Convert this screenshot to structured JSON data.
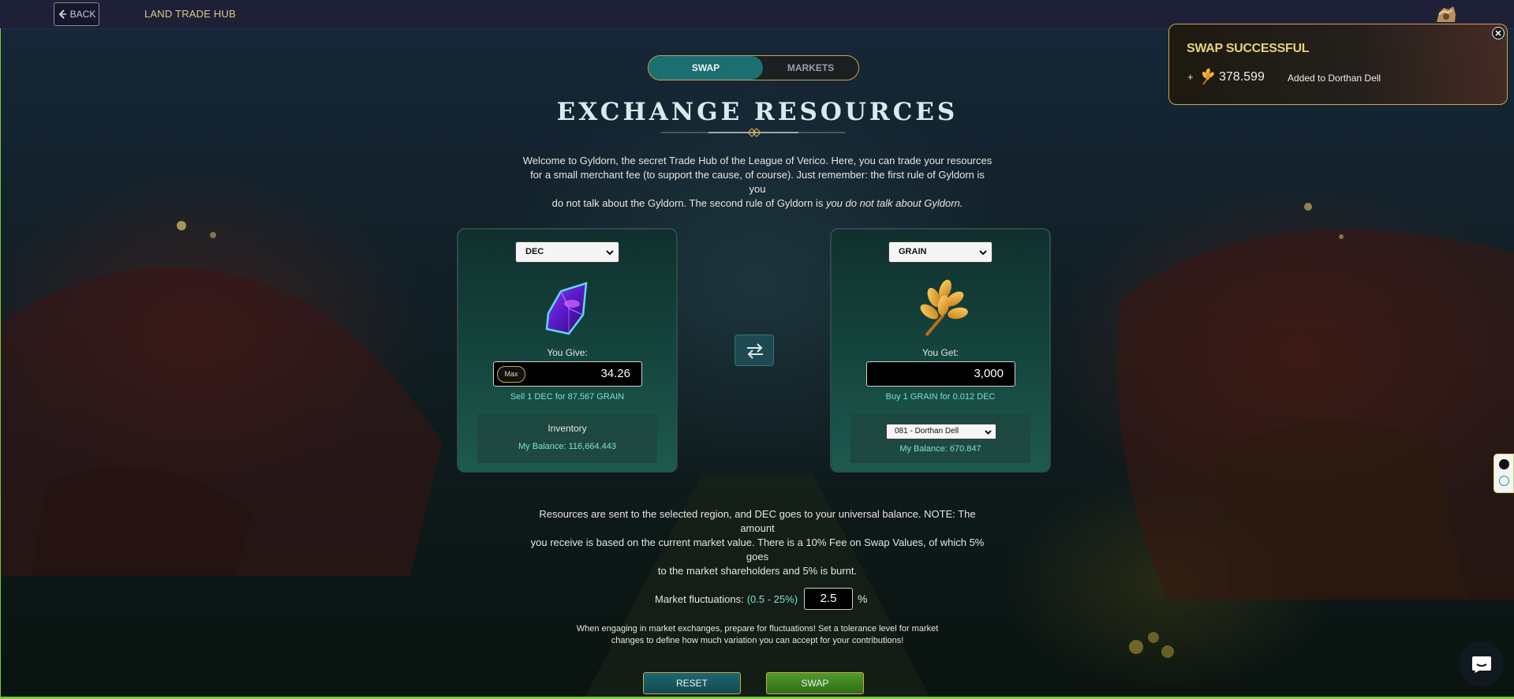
{
  "topbar": {
    "back_label": "BACK",
    "title": "LAND TRADE HUB"
  },
  "tabs": [
    {
      "label": "SWAP",
      "active": true
    },
    {
      "label": "MARKETS",
      "active": false
    }
  ],
  "page": {
    "title": "EXCHANGE RESOURCES",
    "intro_line1": "Welcome to Gyldorn, the secret Trade Hub of the League of Verico. Here, you can trade your resources",
    "intro_line2": "for a small merchant fee (to support the cause, of course). Just remember: the first rule of Gyldorn is you",
    "intro_line3_plain": "do not talk about the Gyldorn. The second rule of Gyldorn is ",
    "intro_line3_italic": "you do not talk about Gyldorn."
  },
  "give_panel": {
    "token": "DEC",
    "label": "You Give:",
    "max_label": "Max",
    "amount": "34.26",
    "rate": "Sell 1 DEC for 87.567 GRAIN",
    "inventory_title": "Inventory",
    "balance": "My Balance: 116,664.443"
  },
  "get_panel": {
    "token": "GRAIN",
    "label": "You Get:",
    "amount": "3,000",
    "rate": "Buy 1 GRAIN for 0.012 DEC",
    "region": "081 - Dorthan Dell",
    "balance": "My Balance: 670.847"
  },
  "note": {
    "line1": "Resources are sent to the selected region, and DEC goes to your universal balance. NOTE: The amount",
    "line2": "you receive is based on the current market value. There is a 10% Fee on Swap Values, of which 5% goes",
    "line3": "to the market shareholders and 5% is burnt."
  },
  "fluctuation": {
    "label": "Market fluctuations:",
    "range": "(0.5 - 25%)",
    "value": "2.5",
    "unit": "%",
    "help_line1": "When engaging in market exchanges, prepare for fluctuations! Set a tolerance level for market",
    "help_line2": "changes to define how much variation you can accept for your contributions!"
  },
  "actions": {
    "reset_label": "RESET",
    "swap_label": "SWAP"
  },
  "toast": {
    "title": "SWAP SUCCESSFUL",
    "plus": "+",
    "amount": "378.599",
    "message": "Added to Dorthan Dell"
  },
  "icons": {
    "back": "chevron-left-icon",
    "swap_direction": "swap-arrows-icon",
    "dec": "crystal-icon",
    "grain": "wheat-icon",
    "close": "close-icon",
    "chat": "chat-icon"
  },
  "colors": {
    "accent_gold": "#c9a84c",
    "accent_teal": "#1b6e72",
    "success_green": "#4f9a2c",
    "highlight_text": "#7ee0d4"
  }
}
